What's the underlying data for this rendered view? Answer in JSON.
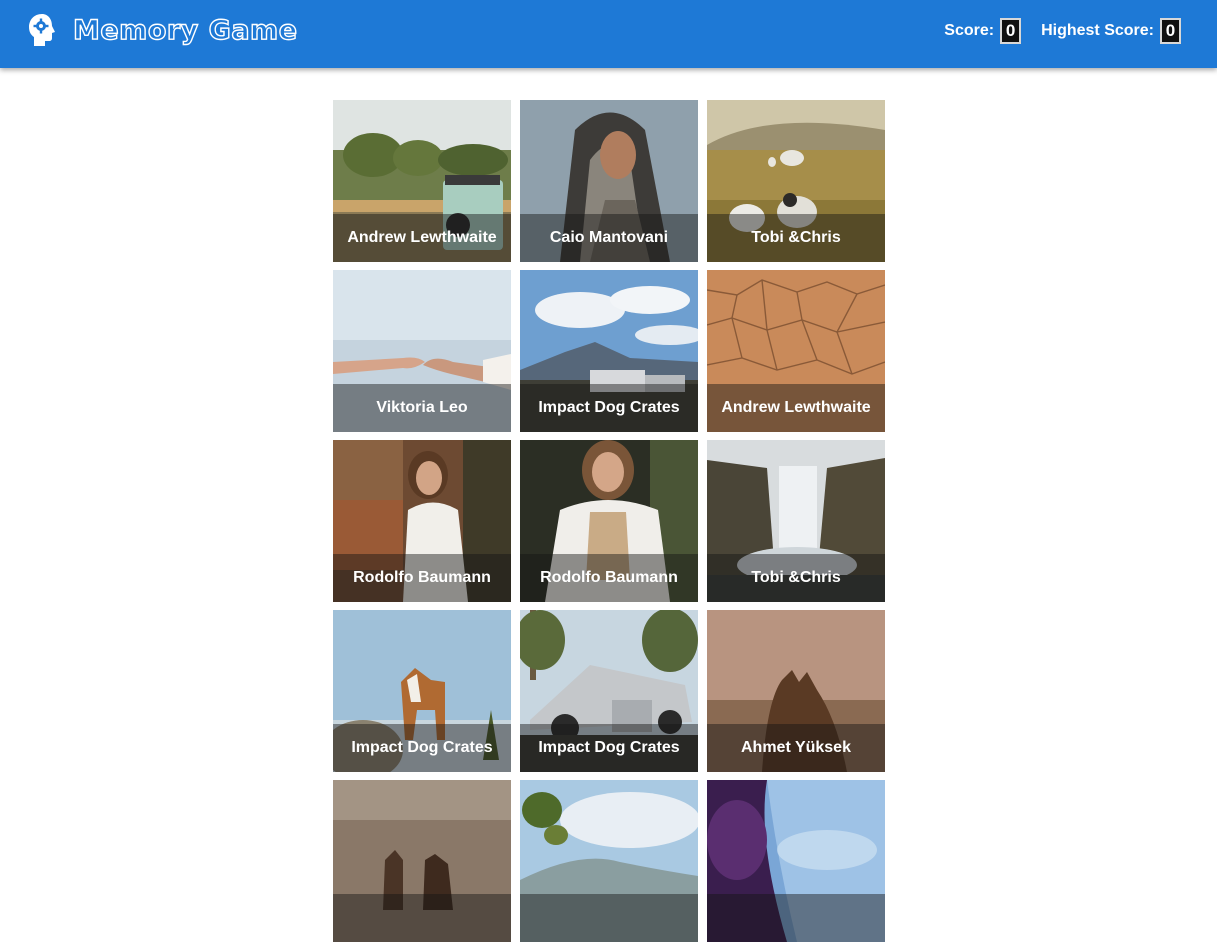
{
  "header": {
    "title": "Memory Game",
    "score_label": "Score:",
    "score_value": "0",
    "highest_label": "Highest Score:",
    "highest_value": "0",
    "brand_color": "#1e79d6",
    "logo_icon": "head-gear-icon"
  },
  "cards": [
    {
      "credit": "Andrew Lewthwaite",
      "scene": "safari-truck-landscape"
    },
    {
      "credit": "Caio Mantovani",
      "scene": "woman-with-scarf"
    },
    {
      "credit": "Tobi &Chris",
      "scene": "sheep-in-field"
    },
    {
      "credit": "Viktoria Leo",
      "scene": "hands-reaching"
    },
    {
      "credit": "Impact Dog Crates",
      "scene": "mountain-with-truck"
    },
    {
      "credit": "Andrew Lewthwaite",
      "scene": "cracked-desert-ground"
    },
    {
      "credit": "Rodolfo Baumann",
      "scene": "woman-with-glasses"
    },
    {
      "credit": "Rodolfo Baumann",
      "scene": "woman-in-white-shirt"
    },
    {
      "credit": "Tobi &Chris",
      "scene": "waterfall"
    },
    {
      "credit": "Impact Dog Crates",
      "scene": "husky-on-rock"
    },
    {
      "credit": "Impact Dog Crates",
      "scene": "cybertruck-with-dog"
    },
    {
      "credit": "Ahmet Yüksek",
      "scene": "horse-close-up"
    },
    {
      "credit": "",
      "scene": "two-horses"
    },
    {
      "credit": "",
      "scene": "hill-and-leaves"
    },
    {
      "credit": "",
      "scene": "purple-water"
    }
  ]
}
